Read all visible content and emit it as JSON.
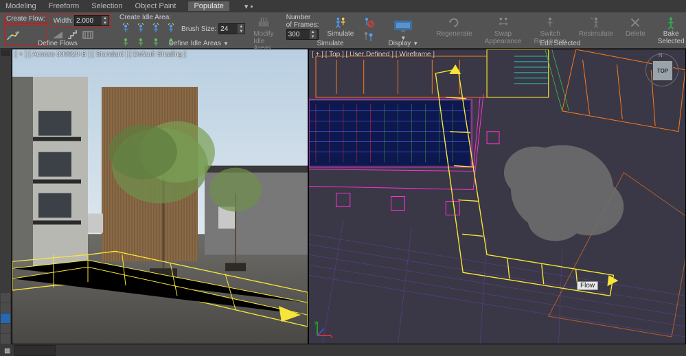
{
  "tabs": {
    "items": [
      "Modeling",
      "Freeform",
      "Selection",
      "Object Paint",
      "Populate"
    ],
    "active": 4
  },
  "ribbon": {
    "define_flows": {
      "create_flow_label": "Create Flow:",
      "width_label": "Width:",
      "width_value": "2.000",
      "title": "Define Flows"
    },
    "define_idle": {
      "create_idle_label": "Create Idle Area:",
      "brush_label": "Brush Size:",
      "brush_value": "24",
      "modify_label1": "Modify",
      "modify_label2": "Idle Areas",
      "title": "Define Idle Areas"
    },
    "simulate": {
      "num_frames_label1": "Number",
      "num_frames_label2": "of Frames:",
      "num_frames_value": "300",
      "simulate_label": "Simulate",
      "title": "Simulate"
    },
    "display": {
      "title": "Display"
    },
    "edit_selected": {
      "regenerate": "Regenerate",
      "swap1": "Swap",
      "swap2": "Appearance",
      "switch1": "Switch",
      "switch2": "Resolution",
      "resimulate": "Resimulate",
      "delete": "Delete",
      "bake1": "Bake",
      "bake2": "Selected",
      "title": "Edit Selected"
    }
  },
  "viewports": {
    "left_label": "[ + ] [ Acceso 300920-B ] [ Standard ] [ Default Shading ]",
    "right_label": "[ + ] [ Top ] [ User Defined ] [ Wireframe ]",
    "flow_object_label": "Flow",
    "viewcube_face": "TOP",
    "viewcube_north": "N"
  },
  "status": {
    "text": ""
  },
  "icons": {
    "create_flow": "create-flow-icon",
    "ramp": "ramp-icon",
    "stairs": "stairs-icon",
    "crosswalk": "crosswalk-icon",
    "idle1": "idle-stand-icon",
    "idle2": "idle-stand-icon",
    "idle3": "idle-stand-icon",
    "idle4": "idle-stand-icon",
    "idle5": "idle-walk-icon",
    "idle6": "idle-walk-icon",
    "idle7": "idle-walk-icon",
    "idle8": "idle-walk-icon",
    "modify": "modify-idle-icon",
    "simulate": "simulate-icon",
    "delete_people": "delete-people-icon",
    "scale_people": "scale-people-icon",
    "display": "display-icon",
    "regenerate": "regenerate-icon",
    "swap": "swap-appearance-icon",
    "switch": "switch-resolution-icon",
    "resim": "resimulate-icon",
    "delete": "delete-icon",
    "bake": "bake-icon"
  }
}
